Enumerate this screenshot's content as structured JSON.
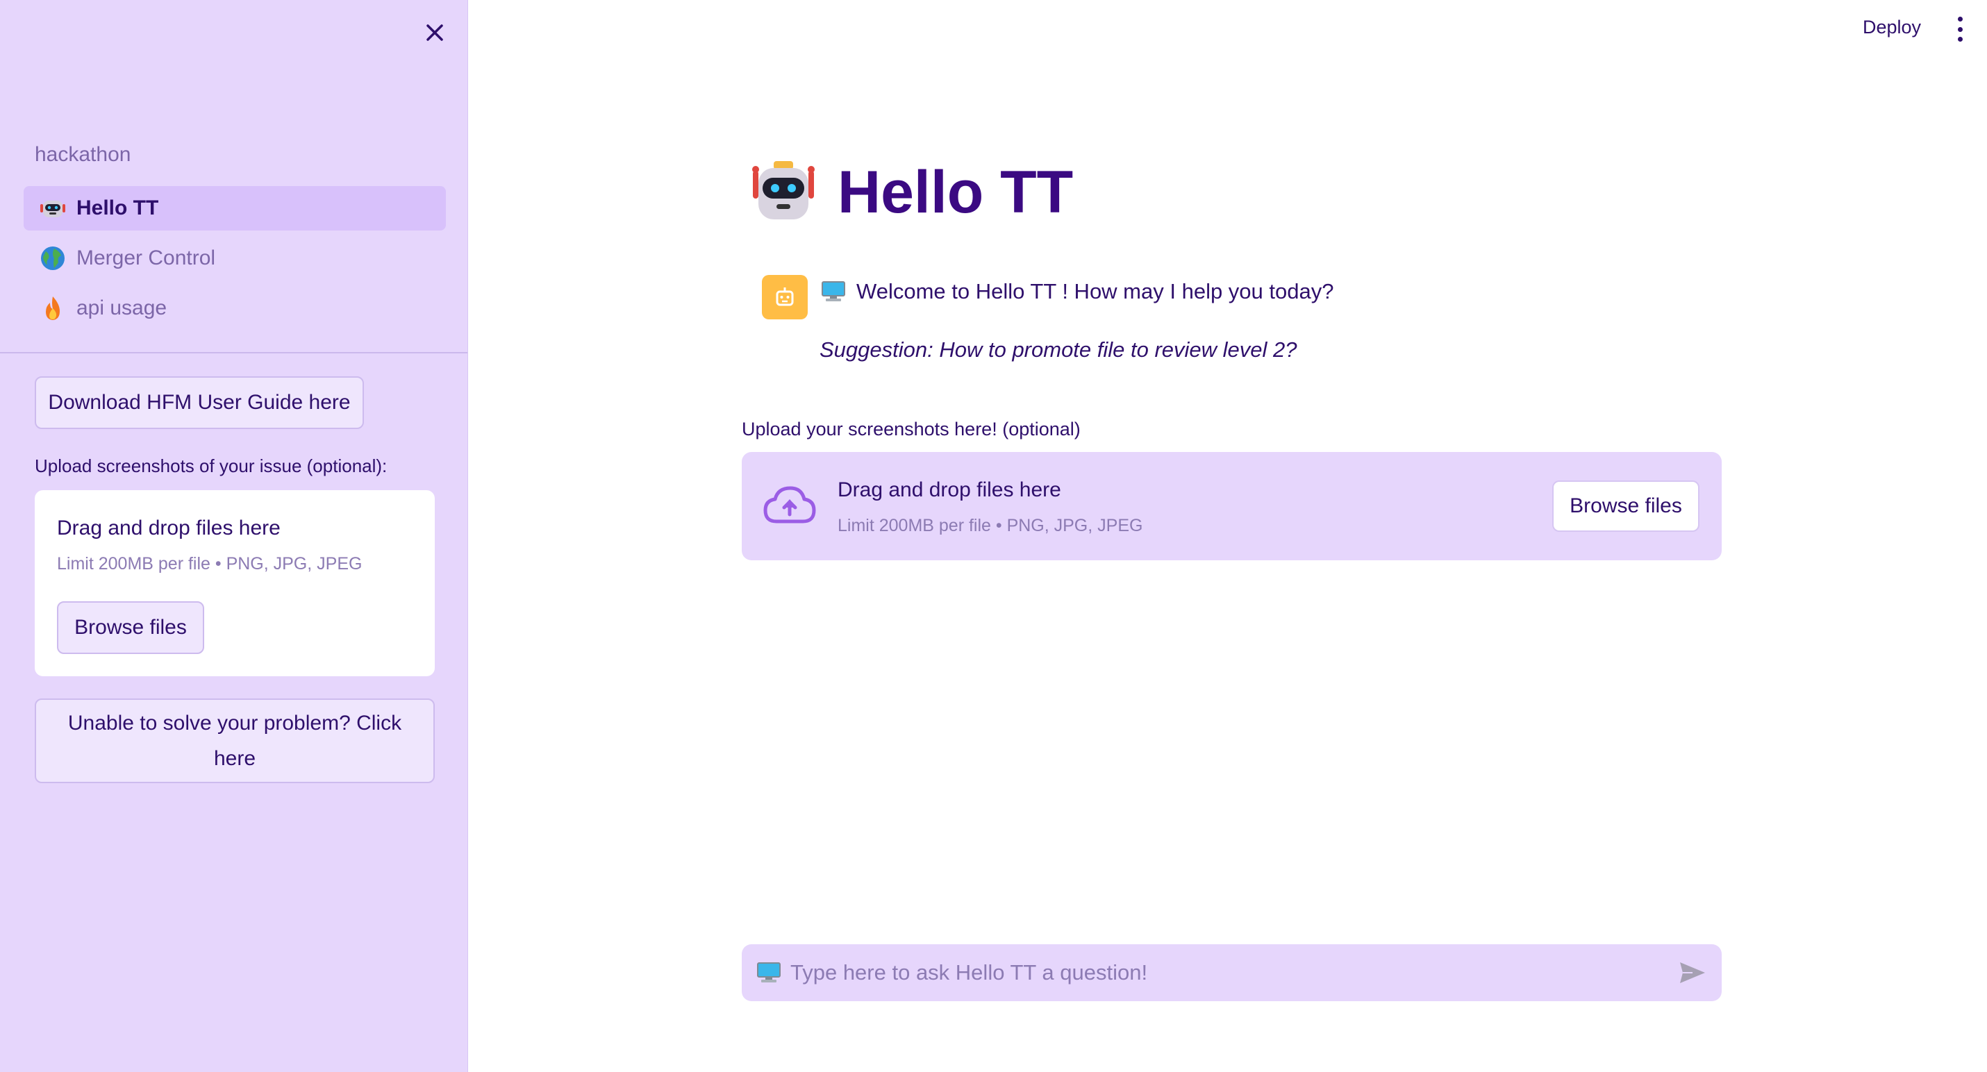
{
  "colors": {
    "sidebar_bg": "#e6d6fc",
    "accent": "#3b0a82",
    "active_nav": "#d8c1fb",
    "avatar_bg": "#ffbd45",
    "upload_icon": "#9b5de5"
  },
  "header": {
    "deploy_label": "Deploy",
    "menu_icon": "kebab-menu-icon"
  },
  "sidebar": {
    "close_icon": "close-icon",
    "nav_heading": "hackathon",
    "nav_items": [
      {
        "label": "Hello TT",
        "icon": "robot-icon",
        "active": true
      },
      {
        "label": "Merger Control",
        "icon": "globe-icon",
        "active": false
      },
      {
        "label": "api usage",
        "icon": "fire-icon",
        "active": false
      }
    ],
    "download_button": "Download HFM User Guide here",
    "upload_label": "Upload screenshots of your issue (optional):",
    "uploader": {
      "title": "Drag and drop files here",
      "limit": "Limit 200MB per file • PNG, JPG, JPEG",
      "browse": "Browse files"
    },
    "help_button": "Unable to solve your problem? Click here"
  },
  "main": {
    "title": "Hello TT",
    "title_icon": "robot-icon",
    "message": {
      "avatar_icon": "bot-avatar-icon",
      "icon": "computer-icon",
      "text": "Welcome to Hello TT ! How may I help you today?",
      "suggestion": "Suggestion: How to promote file to review level 2?"
    },
    "upload_label": "Upload your screenshots here! (optional)",
    "uploader": {
      "icon": "cloud-upload-icon",
      "title": "Drag and drop files here",
      "limit": "Limit 200MB per file • PNG, JPG, JPEG",
      "browse": "Browse files"
    },
    "chat_input": {
      "icon": "computer-icon",
      "placeholder": "Type here to ask Hello TT a question!",
      "send_icon": "send-icon"
    }
  }
}
